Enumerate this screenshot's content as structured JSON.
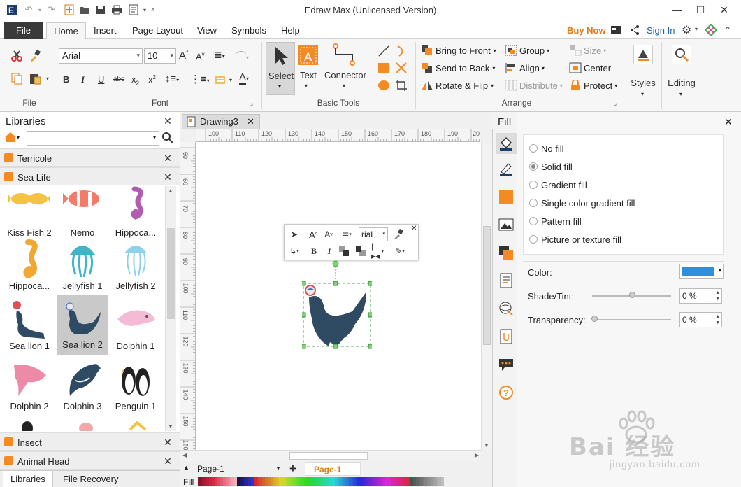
{
  "app": {
    "title": "Edraw Max (Unlicensed Version)"
  },
  "menu": {
    "file": "File",
    "tabs": [
      "Home",
      "Insert",
      "Page Layout",
      "View",
      "Symbols",
      "Help"
    ],
    "buy_now": "Buy Now",
    "sign_in": "Sign In"
  },
  "ribbon": {
    "file_group": "File",
    "font_group": "Font",
    "basic_tools_group": "Basic Tools",
    "arrange_group": "Arrange",
    "font_name": "Arial",
    "font_size": "10",
    "select": "Select",
    "text": "Text",
    "connector": "Connector",
    "bring_to_front": "Bring to Front",
    "send_to_back": "Send to Back",
    "rotate_flip": "Rotate & Flip",
    "group": "Group",
    "align": "Align",
    "distribute": "Distribute",
    "size": "Size",
    "center": "Center",
    "protect": "Protect",
    "styles": "Styles",
    "editing": "Editing"
  },
  "libraries": {
    "title": "Libraries",
    "categories_top": [
      "Terricole",
      "Sea Life"
    ],
    "categories_bottom": [
      "Insect",
      "Animal Head"
    ],
    "shapes": [
      {
        "label": "Kiss Fish 2"
      },
      {
        "label": "Nemo"
      },
      {
        "label": "Hippoca..."
      },
      {
        "label": "Hippoca..."
      },
      {
        "label": "Jellyfish 1"
      },
      {
        "label": "Jellyfish 2"
      },
      {
        "label": "Sea lion 1"
      },
      {
        "label": "Sea lion 2"
      },
      {
        "label": "Dolphin 1"
      },
      {
        "label": "Dolphin 2"
      },
      {
        "label": "Dolphin 3"
      },
      {
        "label": "Penguin 1"
      }
    ],
    "bottom_tabs": [
      "Libraries",
      "File Recovery"
    ]
  },
  "document": {
    "tab": "Drawing3",
    "ruler_top": [
      "100",
      "110",
      "120",
      "130",
      "140",
      "150",
      "160",
      "170",
      "180",
      "190",
      "20"
    ],
    "ruler_left": [
      "50",
      "60",
      "70",
      "80",
      "90",
      "100",
      "110",
      "120",
      "130",
      "140",
      "150",
      "160"
    ],
    "page_dropdown": "Page-1",
    "page_tab": "Page-1",
    "fill_label": "Fill",
    "mini_font": "rial"
  },
  "fill_panel": {
    "title": "Fill",
    "options": [
      "No fill",
      "Solid fill",
      "Gradient fill",
      "Single color gradient fill",
      "Pattern fill",
      "Picture or texture fill"
    ],
    "selected": "Solid fill",
    "color_label": "Color:",
    "color_value": "#2f8fdd",
    "shade_label": "Shade/Tint:",
    "shade_value": "0 %",
    "transparency_label": "Transparency:",
    "transparency_value": "0 %"
  },
  "watermark": {
    "main": "Bai 经验",
    "sub": "jingyan.baidu.com"
  },
  "colors": {
    "accent_orange": "#f28b24",
    "sea_lion": "#2f4a63",
    "selection": "#3cb04a"
  }
}
